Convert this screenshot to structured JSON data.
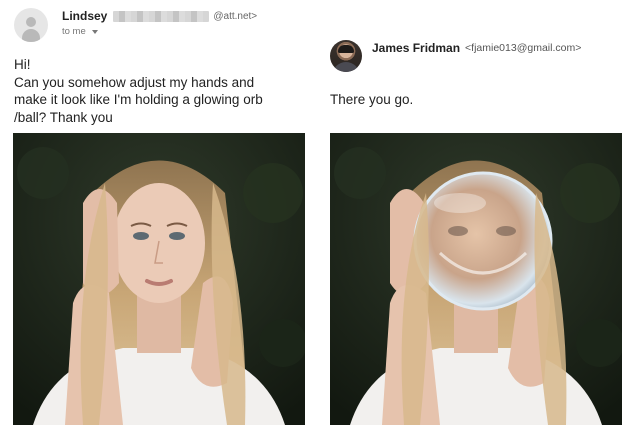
{
  "left_email": {
    "sender_name": "Lindsey",
    "sender_email": "@att.net>",
    "to_label": "to me",
    "message_lines": [
      "Hi!",
      "Can you somehow adjust my hands and",
      "make it look like I'm holding a glowing orb",
      "/ball? Thank you"
    ]
  },
  "right_email": {
    "sender_name": "James Fridman",
    "sender_email": "<fjamie013@gmail.com>",
    "message": "There you go."
  },
  "icons": [
    "avatar-icon",
    "chevron-down-icon",
    "avatar-photo"
  ],
  "colors": {
    "background": "#ffffff",
    "text": "#222222",
    "muted": "#777777",
    "foliage": "#1f2a1c",
    "hair": "#c9a878",
    "skin": "#e9c7b4",
    "orb": "#cfd9e2"
  }
}
